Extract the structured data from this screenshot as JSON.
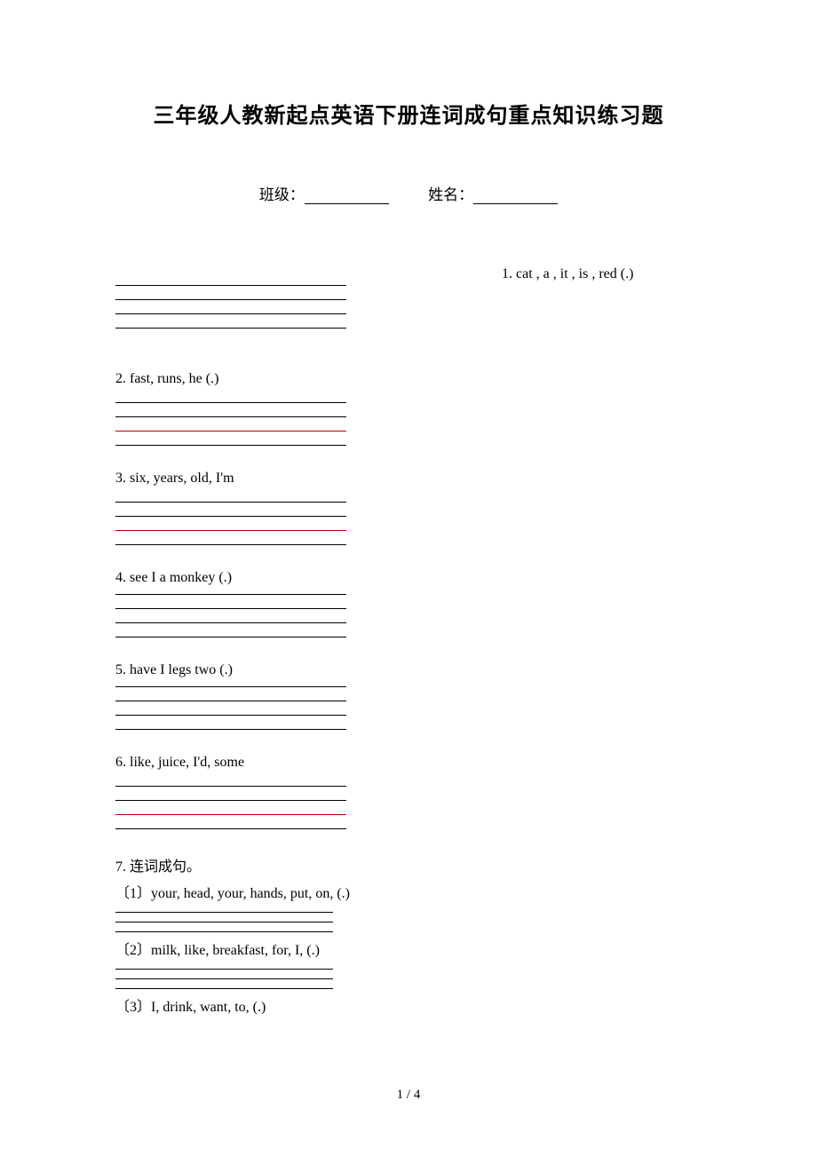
{
  "title": "三年级人教新起点英语下册连词成句重点知识练习题",
  "class_label": "班级：",
  "name_label": "姓名：",
  "q1": "1. cat , a , it , is , red (.)",
  "q2": "2. fast,   runs,   he (.)",
  "q3": "3. six, years, old, I'm",
  "q4": "4. see  I  a  monkey (.)",
  "q5": "5. have I legs two (.)",
  "q6": "6. like, juice, I'd, some",
  "q7_label": "7. 连词成句。",
  "q7_1": "〔1〕your, head, your, hands, put, on, (.)",
  "q7_2": "〔2〕milk, like, breakfast, for, I, (.)",
  "q7_3": "〔3〕I, drink, want, to, (.)",
  "page_num": "1 / 4"
}
